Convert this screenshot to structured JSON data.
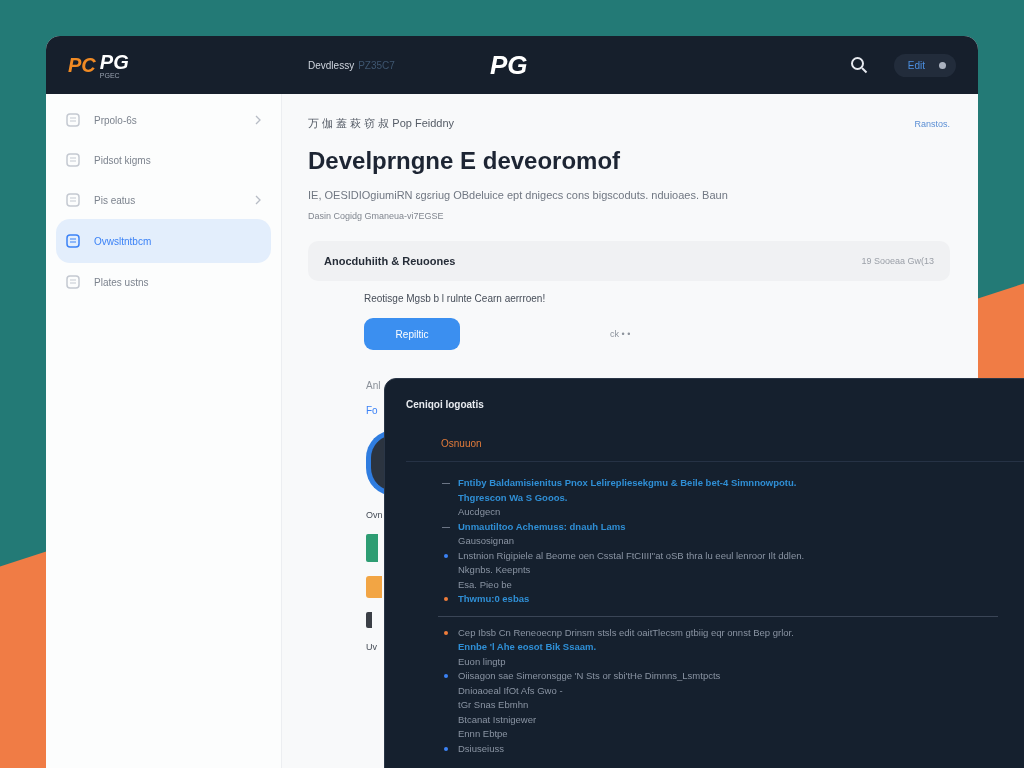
{
  "header": {
    "logo_mark": "PC",
    "logo": "PG",
    "logo_sub": "PGEC",
    "nav": "Devdlessy",
    "nav_faded": "PZ35C7",
    "center_logo": "PG",
    "account": "Edit"
  },
  "sidebar": {
    "items": [
      {
        "label": "Prpolo-6s",
        "chevron": true,
        "selected": false
      },
      {
        "label": "Pidsot kigms",
        "chevron": false,
        "selected": false
      },
      {
        "label": "Pis eatus",
        "chevron": true,
        "selected": false
      },
      {
        "label": "Ovwsltntbcm",
        "chevron": false,
        "selected": true
      },
      {
        "label": "Plates ustns",
        "chevron": false,
        "selected": false
      }
    ]
  },
  "main": {
    "breadcrumb": "万 伽 蓋 萩 窃 叔 Pop Feiddny",
    "top_link": "Ranstos.",
    "title": "Develprngne E deveoromof",
    "description": "IE, OESIDIOgiumiRN ɛgɛriug OBdeluice ept dnigecs cons bigscoduts. nduioaes. Baun",
    "subline": "Dasin Cogidg Gmaneua-vi7EGSE",
    "card": {
      "title": "Anocduhiith & Reuoones",
      "meta": "19 Sooeaa Gw(13"
    },
    "note": "Reotisge Mgsb b l rulnte Cearn aerrroen!",
    "button": "Repiltic",
    "faded": "ck • •",
    "partial": {
      "label": "Anl",
      "link": "Fo",
      "caption": "Ovn",
      "footer": "Uv"
    }
  },
  "panel": {
    "title": "Ceniqoi Iogoatis",
    "section": "Osnuuon",
    "items": [
      {
        "kind": "dash",
        "color": "#6b7585",
        "lines": [
          {
            "text": "Fntiby Baldamisienitus Pnox Lelirepliesekgmu & Beile bet-4 Simnnowpotu.",
            "link": true
          },
          {
            "text": "Thgrescon Wa S Gooos.",
            "link": true
          },
          {
            "text": "Aucdgecn",
            "link": false
          }
        ]
      },
      {
        "kind": "dash",
        "color": "#6b7585",
        "lines": [
          {
            "text": "Unmautiltoo Achemuss: dnauh Lams",
            "link": true
          },
          {
            "text": "Gausosignan",
            "link": false
          }
        ]
      },
      {
        "kind": "dot",
        "color": "#3b82f6",
        "lines": [
          {
            "text": "Lnstnion Rigipiele al Beome oen Csstal FtCIIII\"at oSB thra lu eeul lenroor Ilt ddlen.",
            "link": false
          },
          {
            "text": "Nkgnbs. Keepnts",
            "link": false
          },
          {
            "text": "Esa. Pieo be",
            "link": false
          }
        ]
      },
      {
        "kind": "dot",
        "color": "#f07c3a",
        "lines": [
          {
            "text": "Thwmu:0 esbas",
            "link": true
          }
        ]
      },
      {
        "kind": "rule"
      },
      {
        "kind": "dot",
        "color": "#f07c3a",
        "lines": [
          {
            "text": "Cep Ibsb Cn Reneoecnp Drinsm stsls edit oaitTlecsm gtbiig eqr onnst Bep grlor.",
            "link": false
          },
          {
            "text": "Ennbe 'l Ahe eosot Bik Ssaam.",
            "link": true
          },
          {
            "text": "Euon lingtp",
            "link": false
          }
        ]
      },
      {
        "kind": "dot",
        "color": "#3b82f6",
        "lines": [
          {
            "text": "Oiisagon sae Simeronsgge 'N Sts or sbi'tHe Dimnns_Lsmtpcts",
            "link": false
          },
          {
            "text": "Dnioaoeal IfOt Afs Gwo -",
            "link": false
          },
          {
            "text": "tGr Snas Ebmhn",
            "link": false
          },
          {
            "text": "Btcanat Istnigewer",
            "link": false
          },
          {
            "text": "Ennn Ebtpe",
            "link": false
          }
        ]
      },
      {
        "kind": "dot",
        "color": "#3b82f6",
        "lines": [
          {
            "text": "Dsiuseiuss",
            "link": false
          }
        ]
      }
    ]
  }
}
